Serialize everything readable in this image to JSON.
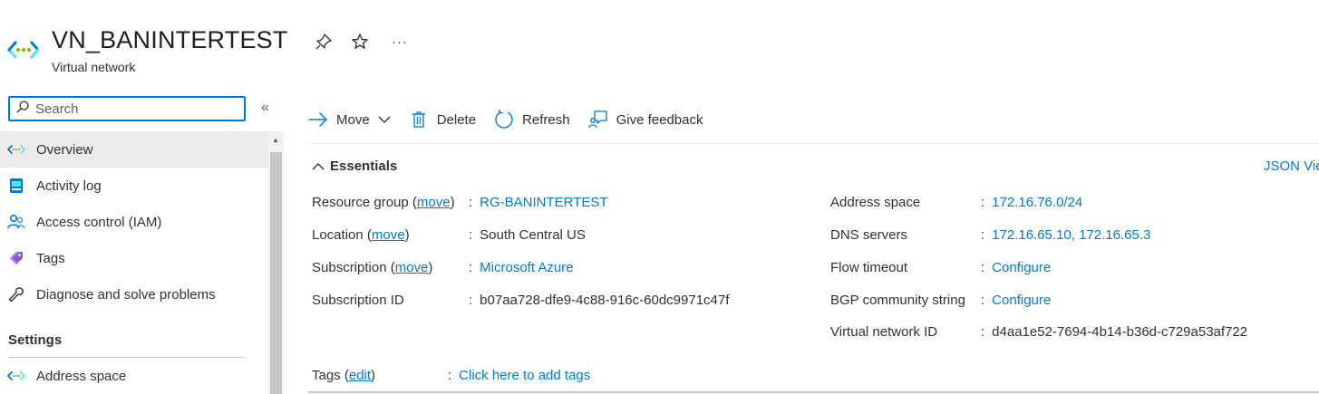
{
  "header": {
    "title": "VN_BANINTERTEST",
    "subtitle": "Virtual network",
    "icon": "virtual-network-icon",
    "more_label": "···"
  },
  "sidebar": {
    "search_placeholder": "Search",
    "collapse_label": "«",
    "items": [
      {
        "label": "Overview",
        "icon": "virtual-network-icon"
      },
      {
        "label": "Activity log",
        "icon": "activity-log-icon"
      },
      {
        "label": "Access control (IAM)",
        "icon": "iam-icon"
      },
      {
        "label": "Tags",
        "icon": "tag-icon"
      },
      {
        "label": "Diagnose and solve problems",
        "icon": "wrench-icon"
      }
    ],
    "section_settings": "Settings",
    "settings_items": [
      {
        "label": "Address space",
        "icon": "virtual-network-icon"
      }
    ]
  },
  "toolbar": {
    "move_label": "Move",
    "delete_label": "Delete",
    "refresh_label": "Refresh",
    "feedback_label": "Give feedback"
  },
  "essentials": {
    "heading": "Essentials",
    "json_view_label": "JSON Vie",
    "move_link": "move",
    "left": [
      {
        "label": "Resource group",
        "value": "RG-BANINTERTEST"
      },
      {
        "label": "Location",
        "value": "South Central US"
      },
      {
        "label": "Subscription",
        "value": "Microsoft Azure"
      },
      {
        "label": "Subscription ID",
        "value": "b07aa728-dfe9-4c88-916c-60dc9971c47f"
      }
    ],
    "right": [
      {
        "label": "Address space",
        "value": "172.16.76.0/24"
      },
      {
        "label": "DNS servers",
        "value": "172.16.65.10, 172.16.65.3"
      },
      {
        "label": "Flow timeout",
        "value": "Configure"
      },
      {
        "label": "BGP community string",
        "value": "Configure"
      },
      {
        "label": "Virtual network ID",
        "value": "d4aa1e52-7694-4b14-b36d-c729a53af722"
      }
    ],
    "tags_label": "Tags",
    "tags_edit": "edit",
    "tags_value": "Click here to add tags"
  },
  "colors": {
    "accent": "#0078d4",
    "text": "#323130",
    "selected_bg": "#edebe9"
  }
}
